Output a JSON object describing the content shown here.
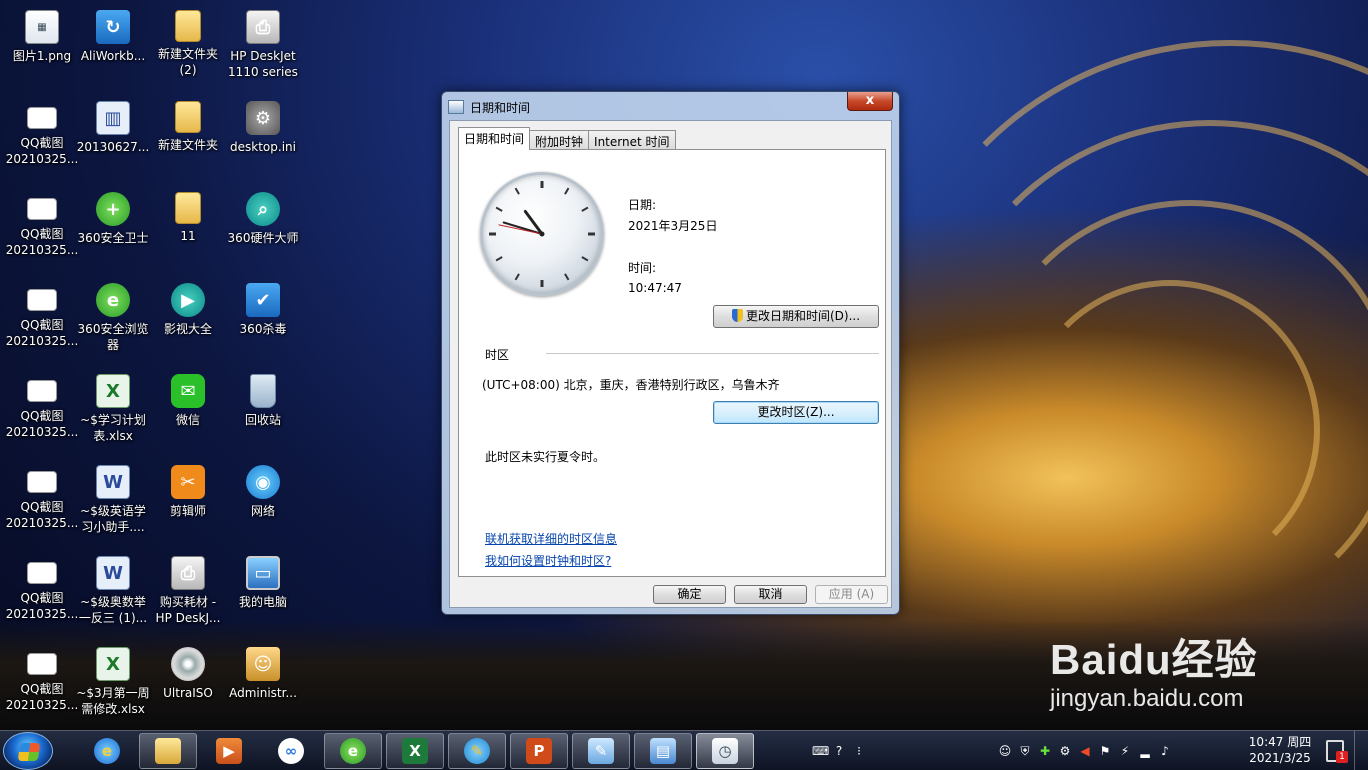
{
  "desktop": {
    "icons": [
      {
        "label": "图片1.png",
        "glyph": "▦"
      },
      {
        "label": "AliWorkb...",
        "glyph": "↻"
      },
      {
        "label": "新建文件夹\n(2)",
        "glyph": ""
      },
      {
        "label": "HP DeskJet\n1110 series",
        "glyph": "⎙"
      },
      {
        "label": "QQ截图\n20210325...",
        "glyph": ""
      },
      {
        "label": "20130627...",
        "glyph": "▥"
      },
      {
        "label": "新建文件夹",
        "glyph": ""
      },
      {
        "label": "desktop.ini",
        "glyph": "⚙"
      },
      {
        "label": "QQ截图\n20210325...",
        "glyph": ""
      },
      {
        "label": "360安全卫士",
        "glyph": "+"
      },
      {
        "label": "11",
        "glyph": ""
      },
      {
        "label": "360硬件大师",
        "glyph": "⌕"
      },
      {
        "label": "QQ截图\n20210325...",
        "glyph": ""
      },
      {
        "label": "360安全浏览\n器",
        "glyph": "e"
      },
      {
        "label": "影视大全",
        "glyph": "▶"
      },
      {
        "label": "360杀毒",
        "glyph": "✔"
      },
      {
        "label": "QQ截图\n20210325...",
        "glyph": ""
      },
      {
        "label": "~$学习计划\n表.xlsx",
        "glyph": "X"
      },
      {
        "label": "微信",
        "glyph": "✉"
      },
      {
        "label": "回收站",
        "glyph": ""
      },
      {
        "label": "QQ截图\n20210325...",
        "glyph": ""
      },
      {
        "label": "~$级英语学\n习小助手....",
        "glyph": "W"
      },
      {
        "label": "剪辑师",
        "glyph": "✂"
      },
      {
        "label": "网络",
        "glyph": "◉"
      },
      {
        "label": "QQ截图\n20210325...",
        "glyph": ""
      },
      {
        "label": "~$级奥数举\n一反三 (1)...",
        "glyph": "W"
      },
      {
        "label": "购买耗材 -\nHP DeskJ...",
        "glyph": "⎙"
      },
      {
        "label": "我的电脑",
        "glyph": "▭"
      },
      {
        "label": "QQ截图\n20210325...",
        "glyph": ""
      },
      {
        "label": "~$3月第一周\n需修改.xlsx",
        "glyph": "X"
      },
      {
        "label": "UltraISO",
        "glyph": ""
      },
      {
        "label": "Administr...",
        "glyph": "☺"
      }
    ]
  },
  "dialog": {
    "title": "日期和时间",
    "close_label": "x",
    "tabs": [
      "日期和时间",
      "附加时钟",
      "Internet 时间"
    ],
    "date_label": "日期:",
    "date_value": "2021年3月25日",
    "time_label": "时间:",
    "time_value": "10:47:47",
    "clock": {
      "hour": 10,
      "minute": 47,
      "second": 47
    },
    "change_datetime_button": "更改日期和时间(D)...",
    "timezone_section_label": "时区",
    "timezone_value": "(UTC+08:00) 北京，重庆，香港特别行政区，乌鲁木齐",
    "change_timezone_button": "更改时区(Z)...",
    "dst_note": "此时区未实行夏令时。",
    "link_online_info": "联机获取详细的时区信息",
    "link_how_to": "我如何设置时钟和时区?",
    "ok_button": "确定",
    "cancel_button": "取消",
    "apply_button": "应用 (A)"
  },
  "taskbar": {
    "pinned": [
      "ie-icon",
      "explorer-icon",
      "media-player-icon",
      "baidu-netdisk-icon",
      "360-browser-icon",
      "excel-icon",
      "pencil-app-icon",
      "powerpoint-icon",
      "notes-icon",
      "control-panel-icon",
      "datetime-icon"
    ],
    "tray_time": "10:47 周四",
    "tray_date": "2021/3/25",
    "notification_count": "1"
  },
  "watermark": {
    "brand": "Baidu经验",
    "url": "jingyan.baidu.com"
  },
  "colors": {
    "link": "#0645ad",
    "close_red": "#c84a2a",
    "taskbar": "#1a2236"
  }
}
